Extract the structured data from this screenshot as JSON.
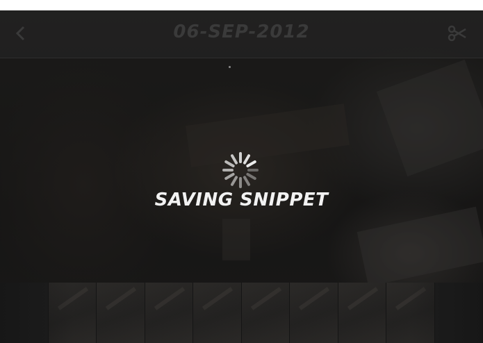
{
  "header": {
    "title": "06-SEP-2012",
    "back_icon": "back-arrow-icon",
    "action_icon": "scissors-icon"
  },
  "overlay": {
    "status_text": "SAVING SNIPPET",
    "spinner_icon": "loading-spinner-icon"
  },
  "filmstrip": {
    "thumbnail_count": 10
  },
  "colors": {
    "background": "#1c1c1c",
    "overlay_text": "#f2f2f2",
    "header_text": "#3a3a3a"
  }
}
